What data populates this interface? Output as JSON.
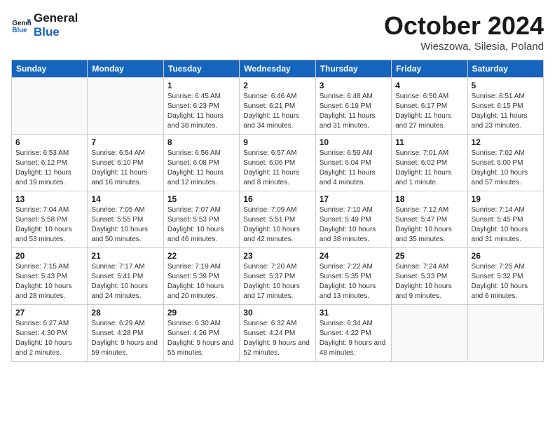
{
  "header": {
    "logo_line1": "General",
    "logo_line2": "Blue",
    "month": "October 2024",
    "location": "Wieszowa, Silesia, Poland"
  },
  "days_of_week": [
    "Sunday",
    "Monday",
    "Tuesday",
    "Wednesday",
    "Thursday",
    "Friday",
    "Saturday"
  ],
  "weeks": [
    [
      {
        "day": "",
        "info": ""
      },
      {
        "day": "",
        "info": ""
      },
      {
        "day": "1",
        "info": "Sunrise: 6:45 AM\nSunset: 6:23 PM\nDaylight: 11 hours and 38 minutes."
      },
      {
        "day": "2",
        "info": "Sunrise: 6:46 AM\nSunset: 6:21 PM\nDaylight: 11 hours and 34 minutes."
      },
      {
        "day": "3",
        "info": "Sunrise: 6:48 AM\nSunset: 6:19 PM\nDaylight: 11 hours and 31 minutes."
      },
      {
        "day": "4",
        "info": "Sunrise: 6:50 AM\nSunset: 6:17 PM\nDaylight: 11 hours and 27 minutes."
      },
      {
        "day": "5",
        "info": "Sunrise: 6:51 AM\nSunset: 6:15 PM\nDaylight: 11 hours and 23 minutes."
      }
    ],
    [
      {
        "day": "6",
        "info": "Sunrise: 6:53 AM\nSunset: 6:12 PM\nDaylight: 11 hours and 19 minutes."
      },
      {
        "day": "7",
        "info": "Sunrise: 6:54 AM\nSunset: 6:10 PM\nDaylight: 11 hours and 16 minutes."
      },
      {
        "day": "8",
        "info": "Sunrise: 6:56 AM\nSunset: 6:08 PM\nDaylight: 11 hours and 12 minutes."
      },
      {
        "day": "9",
        "info": "Sunrise: 6:57 AM\nSunset: 6:06 PM\nDaylight: 11 hours and 8 minutes."
      },
      {
        "day": "10",
        "info": "Sunrise: 6:59 AM\nSunset: 6:04 PM\nDaylight: 11 hours and 4 minutes."
      },
      {
        "day": "11",
        "info": "Sunrise: 7:01 AM\nSunset: 6:02 PM\nDaylight: 11 hours and 1 minute."
      },
      {
        "day": "12",
        "info": "Sunrise: 7:02 AM\nSunset: 6:00 PM\nDaylight: 10 hours and 57 minutes."
      }
    ],
    [
      {
        "day": "13",
        "info": "Sunrise: 7:04 AM\nSunset: 5:58 PM\nDaylight: 10 hours and 53 minutes."
      },
      {
        "day": "14",
        "info": "Sunrise: 7:05 AM\nSunset: 5:55 PM\nDaylight: 10 hours and 50 minutes."
      },
      {
        "day": "15",
        "info": "Sunrise: 7:07 AM\nSunset: 5:53 PM\nDaylight: 10 hours and 46 minutes."
      },
      {
        "day": "16",
        "info": "Sunrise: 7:09 AM\nSunset: 5:51 PM\nDaylight: 10 hours and 42 minutes."
      },
      {
        "day": "17",
        "info": "Sunrise: 7:10 AM\nSunset: 5:49 PM\nDaylight: 10 hours and 38 minutes."
      },
      {
        "day": "18",
        "info": "Sunrise: 7:12 AM\nSunset: 5:47 PM\nDaylight: 10 hours and 35 minutes."
      },
      {
        "day": "19",
        "info": "Sunrise: 7:14 AM\nSunset: 5:45 PM\nDaylight: 10 hours and 31 minutes."
      }
    ],
    [
      {
        "day": "20",
        "info": "Sunrise: 7:15 AM\nSunset: 5:43 PM\nDaylight: 10 hours and 28 minutes."
      },
      {
        "day": "21",
        "info": "Sunrise: 7:17 AM\nSunset: 5:41 PM\nDaylight: 10 hours and 24 minutes."
      },
      {
        "day": "22",
        "info": "Sunrise: 7:19 AM\nSunset: 5:39 PM\nDaylight: 10 hours and 20 minutes."
      },
      {
        "day": "23",
        "info": "Sunrise: 7:20 AM\nSunset: 5:37 PM\nDaylight: 10 hours and 17 minutes."
      },
      {
        "day": "24",
        "info": "Sunrise: 7:22 AM\nSunset: 5:35 PM\nDaylight: 10 hours and 13 minutes."
      },
      {
        "day": "25",
        "info": "Sunrise: 7:24 AM\nSunset: 5:33 PM\nDaylight: 10 hours and 9 minutes."
      },
      {
        "day": "26",
        "info": "Sunrise: 7:25 AM\nSunset: 5:32 PM\nDaylight: 10 hours and 6 minutes."
      }
    ],
    [
      {
        "day": "27",
        "info": "Sunrise: 6:27 AM\nSunset: 4:30 PM\nDaylight: 10 hours and 2 minutes."
      },
      {
        "day": "28",
        "info": "Sunrise: 6:29 AM\nSunset: 4:28 PM\nDaylight: 9 hours and 59 minutes."
      },
      {
        "day": "29",
        "info": "Sunrise: 6:30 AM\nSunset: 4:26 PM\nDaylight: 9 hours and 55 minutes."
      },
      {
        "day": "30",
        "info": "Sunrise: 6:32 AM\nSunset: 4:24 PM\nDaylight: 9 hours and 52 minutes."
      },
      {
        "day": "31",
        "info": "Sunrise: 6:34 AM\nSunset: 4:22 PM\nDaylight: 9 hours and 48 minutes."
      },
      {
        "day": "",
        "info": ""
      },
      {
        "day": "",
        "info": ""
      }
    ]
  ]
}
